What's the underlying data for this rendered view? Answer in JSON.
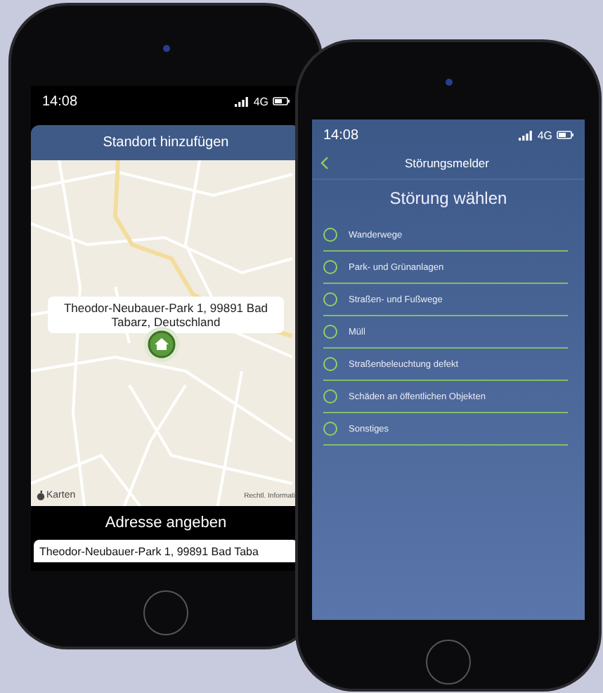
{
  "left_phone": {
    "status_bar": {
      "time": "14:08",
      "network": "4G"
    },
    "header": {
      "title": "Standort hinzufügen"
    },
    "map": {
      "address_label": "Theodor-Neubauer-Park 1, 99891 Bad Tabarz, Deutschland",
      "attribution": "Karten",
      "legal_link": "Rechtl. Informati"
    },
    "address_bar": {
      "title": "Adresse angeben"
    },
    "address_field": {
      "value": "Theodor-Neubauer-Park 1, 99891 Bad Taba"
    }
  },
  "right_phone": {
    "status_bar": {
      "time": "14:08",
      "network": "4G"
    },
    "nav": {
      "title": "Störungsmelder"
    },
    "heading": "Störung wählen",
    "options": [
      {
        "label": "Wanderwege",
        "selected": false
      },
      {
        "label": "Park- und Grünanlagen",
        "selected": false
      },
      {
        "label": "Straßen- und Fußwege",
        "selected": false
      },
      {
        "label": "Müll",
        "selected": false
      },
      {
        "label": "Straßenbeleuchtung defekt",
        "selected": false
      },
      {
        "label": "Schäden an öffentlichen Objekten",
        "selected": false
      },
      {
        "label": "Sonstiges",
        "selected": false
      }
    ]
  }
}
